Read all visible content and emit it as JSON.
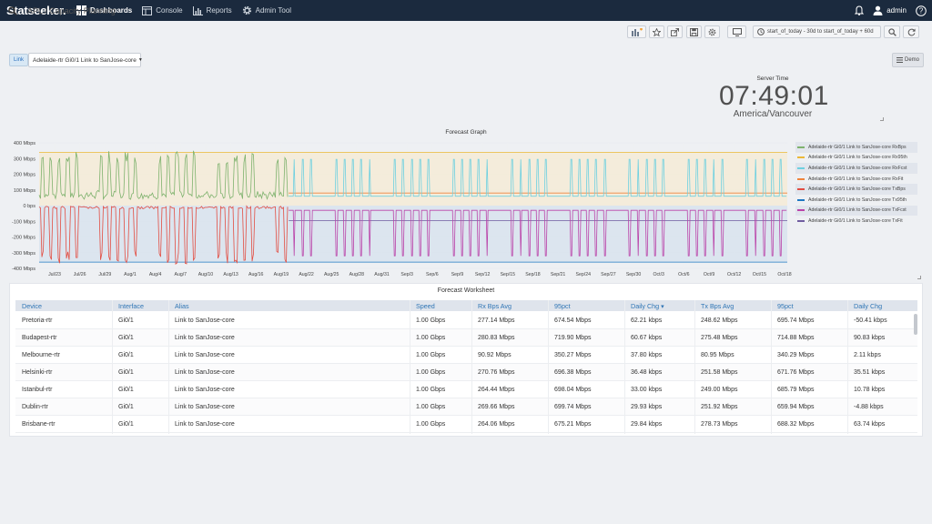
{
  "app": {
    "logo": "Statseeker."
  },
  "nav": {
    "items": [
      {
        "label": "Dashboards",
        "icon": "grid-icon",
        "active": true
      },
      {
        "label": "Console",
        "icon": "window-icon",
        "active": false
      },
      {
        "label": "Reports",
        "icon": "bar-chart-icon",
        "active": false
      },
      {
        "label": "Admin Tool",
        "icon": "gear-icon",
        "active": false
      }
    ]
  },
  "topright": {
    "user": "admin",
    "icons": [
      "bell-icon",
      "user-icon",
      "help-icon"
    ]
  },
  "breadcrumb": "APL / Capacity Planning",
  "toolbar": {
    "icons": [
      "add-panel-icon",
      "star-icon",
      "share-icon",
      "save-icon",
      "settings-icon",
      "monitor-icon",
      "zoom-out-icon",
      "refresh-icon"
    ],
    "timerange": "start_of_today - 30d to start_of_today + 60d"
  },
  "filter": {
    "link_label": "Link",
    "link_value": "Adelaide-rtr Gi0/1 Link to SanJose-core"
  },
  "demo_label": "Demo",
  "clock": {
    "label": "Server Time",
    "time": "07:49:01",
    "timezone": "America/Vancouver"
  },
  "graph": {
    "title": "Forecast Graph"
  },
  "chart_data": {
    "type": "line",
    "title": "Forecast Graph",
    "ylabel": "",
    "yticks": [
      "400 Mbps",
      "300 Mbps",
      "200 Mbps",
      "100 Mbps",
      "0 bps",
      "-100 Mbps",
      "-200 Mbps",
      "-300 Mbps",
      "-400 Mbps"
    ],
    "ylim": [
      -400,
      400
    ],
    "xticks": [
      "Jul/23",
      "Jul/26",
      "Jul/29",
      "Aug/1",
      "Aug/4",
      "Aug/7",
      "Aug/10",
      "Aug/13",
      "Aug/16",
      "Aug/19",
      "Aug/22",
      "Aug/25",
      "Aug/28",
      "Aug/31",
      "Sep/3",
      "Sep/6",
      "Sep/9",
      "Sep/12",
      "Sep/15",
      "Sep/18",
      "Sep/21",
      "Sep/24",
      "Sep/27",
      "Sep/30",
      "Oct/3",
      "Oct/6",
      "Oct/9",
      "Oct/12",
      "Oct/15",
      "Oct/18"
    ],
    "history_end_tick": 9.3,
    "legend": [
      {
        "name": "Adelaide-rtr Gi0/1 Link to SanJose-core RxBps",
        "color": "#7eb26d",
        "hl": true
      },
      {
        "name": "Adelaide-rtr Gi0/1 Link to SanJose-core Rx95th",
        "color": "#eab839",
        "hl": false
      },
      {
        "name": "Adelaide-rtr Gi0/1 Link to SanJose-core RxFcst",
        "color": "#6ed0e0",
        "hl": true
      },
      {
        "name": "Adelaide-rtr Gi0/1 Link to SanJose-core RxFit",
        "color": "#ef843c",
        "hl": false
      },
      {
        "name": "Adelaide-rtr Gi0/1 Link to SanJose-core TxBps",
        "color": "#e24d42",
        "hl": true
      },
      {
        "name": "Adelaide-rtr Gi0/1 Link to SanJose-core Tx95th",
        "color": "#1f78c1",
        "hl": false
      },
      {
        "name": "Adelaide-rtr Gi0/1 Link to SanJose-core TxFcst",
        "color": "#ba43a9",
        "hl": true
      },
      {
        "name": "Adelaide-rtr Gi0/1 Link to SanJose-core TxFit",
        "color": "#705da0",
        "hl": false
      }
    ],
    "series": [
      {
        "name": "RxBps",
        "peak": 350,
        "base": 60
      },
      {
        "name": "Rx95th",
        "value": 340
      },
      {
        "name": "RxFcst",
        "peak": 295,
        "base": 60
      },
      {
        "name": "RxFit",
        "value": 80
      },
      {
        "name": "TxBps",
        "peak": -375,
        "base": -5
      },
      {
        "name": "Tx95th",
        "value": -360
      },
      {
        "name": "TxFcst",
        "peak": -320,
        "base": -30
      },
      {
        "name": "TxFit",
        "value": -95
      }
    ]
  },
  "worksheet": {
    "title": "Forecast Worksheet",
    "columns": [
      "Device",
      "Interface",
      "Alias",
      "Speed",
      "Rx Bps Avg",
      "95pct",
      "Daily Chg",
      "Tx Bps Avg",
      "95pct",
      "Daily Chg"
    ],
    "sort_indicator": "▾",
    "rows": [
      [
        "Pretoria-rtr",
        "Gi0/1",
        "Link to SanJose-core",
        "1.00 Gbps",
        "277.14 Mbps",
        "674.54 Mbps",
        "62.21 kbps",
        "248.62 Mbps",
        "695.74 Mbps",
        "-50.41 kbps"
      ],
      [
        "Budapest-rtr",
        "Gi0/1",
        "Link to SanJose-core",
        "1.00 Gbps",
        "280.83 Mbps",
        "719.90 Mbps",
        "60.67 kbps",
        "275.48 Mbps",
        "714.88 Mbps",
        "90.83 kbps"
      ],
      [
        "Melbourne-rtr",
        "Gi0/1",
        "Link to SanJose-core",
        "1.00 Gbps",
        "90.92 Mbps",
        "350.27 Mbps",
        "37.80 kbps",
        "80.95 Mbps",
        "340.29 Mbps",
        "2.11 kbps"
      ],
      [
        "Helsinki-rtr",
        "Gi0/1",
        "Link to SanJose-core",
        "1.00 Gbps",
        "270.76 Mbps",
        "696.38 Mbps",
        "36.48 kbps",
        "251.58 Mbps",
        "671.76 Mbps",
        "35.51 kbps"
      ],
      [
        "Istanbul-rtr",
        "Gi0/1",
        "Link to SanJose-core",
        "1.00 Gbps",
        "264.44 Mbps",
        "698.04 Mbps",
        "33.00 kbps",
        "249.00 Mbps",
        "685.79 Mbps",
        "10.78 kbps"
      ],
      [
        "Dublin-rtr",
        "Gi0/1",
        "Link to SanJose-core",
        "1.00 Gbps",
        "269.66 Mbps",
        "699.74 Mbps",
        "29.93 kbps",
        "251.92 Mbps",
        "659.94 Mbps",
        "-4.88 kbps"
      ],
      [
        "Brisbane-rtr",
        "Gi0/1",
        "Link to SanJose-core",
        "1.00 Gbps",
        "264.06 Mbps",
        "675.21 Mbps",
        "29.84 kbps",
        "278.73 Mbps",
        "688.32 Mbps",
        "63.74 kbps"
      ]
    ]
  }
}
